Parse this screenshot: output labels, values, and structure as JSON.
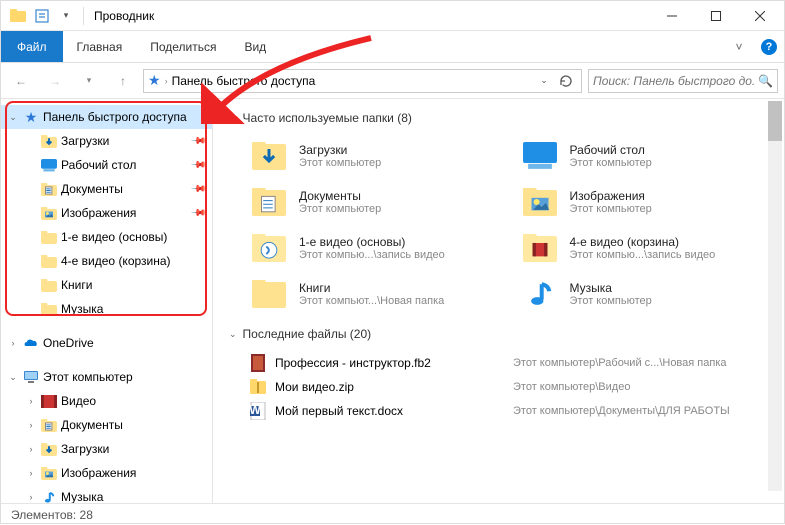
{
  "window": {
    "title": "Проводник",
    "minimize_tip": "Minimize",
    "maximize_tip": "Maximize",
    "close_tip": "Close"
  },
  "ribbon": {
    "file": "Файл",
    "tabs": [
      "Главная",
      "Поделиться",
      "Вид"
    ]
  },
  "address": {
    "crumb": "Панель быстрого доступа"
  },
  "search": {
    "placeholder": "Поиск: Панель быстрого до..."
  },
  "nav": {
    "quick_access": "Панель быстрого доступа",
    "items": [
      {
        "label": "Загрузки",
        "pinned": true,
        "icon": "downloads"
      },
      {
        "label": "Рабочий стол",
        "pinned": true,
        "icon": "desktop"
      },
      {
        "label": "Документы",
        "pinned": true,
        "icon": "documents"
      },
      {
        "label": "Изображения",
        "pinned": true,
        "icon": "pictures"
      },
      {
        "label": "1-е видео (основы)",
        "pinned": false,
        "icon": "folder"
      },
      {
        "label": "4-е видео (корзина)",
        "pinned": false,
        "icon": "folder"
      },
      {
        "label": "Книги",
        "pinned": false,
        "icon": "folder"
      },
      {
        "label": "Музыка",
        "pinned": false,
        "icon": "folder"
      }
    ],
    "onedrive": "OneDrive",
    "this_pc": "Этот компьютер",
    "pc_items": [
      {
        "label": "Видео",
        "icon": "videos"
      },
      {
        "label": "Документы",
        "icon": "documents"
      },
      {
        "label": "Загрузки",
        "icon": "downloads"
      },
      {
        "label": "Изображения",
        "icon": "pictures"
      },
      {
        "label": "Музыка",
        "icon": "music"
      }
    ]
  },
  "sections": {
    "frequent": {
      "title": "Часто используемые папки (8)"
    },
    "recent": {
      "title": "Последние файлы (20)"
    }
  },
  "folders": [
    {
      "name": "Загрузки",
      "sub": "Этот компьютер",
      "icon": "downloads"
    },
    {
      "name": "Рабочий стол",
      "sub": "Этот компьютер",
      "icon": "desktop"
    },
    {
      "name": "Документы",
      "sub": "Этот компьютер",
      "icon": "documents"
    },
    {
      "name": "Изображения",
      "sub": "Этот компьютер",
      "icon": "pictures"
    },
    {
      "name": "1-е видео (основы)",
      "sub": "Этот компью...\\запись видео",
      "icon": "folder-video"
    },
    {
      "name": "4-е видео (корзина)",
      "sub": "Этот компью...\\запись видео",
      "icon": "folder-video2"
    },
    {
      "name": "Книги",
      "sub": "Этот компьют...\\Новая папка",
      "icon": "folder"
    },
    {
      "name": "Музыка",
      "sub": "Этот компьютер",
      "icon": "music"
    }
  ],
  "files": [
    {
      "name": "Профессия - инструктор.fb2",
      "path": "Этот компьютер\\Рабочий с...\\Новая папка",
      "icon": "fb2"
    },
    {
      "name": "Мои видео.zip",
      "path": "Этот компьютер\\Видео",
      "icon": "zip"
    },
    {
      "name": "Мой первый текст.docx",
      "path": "Этот компьютер\\Документы\\ДЛЯ РАБОТЫ",
      "icon": "docx"
    }
  ],
  "status": {
    "count_label": "Элементов: 28"
  }
}
